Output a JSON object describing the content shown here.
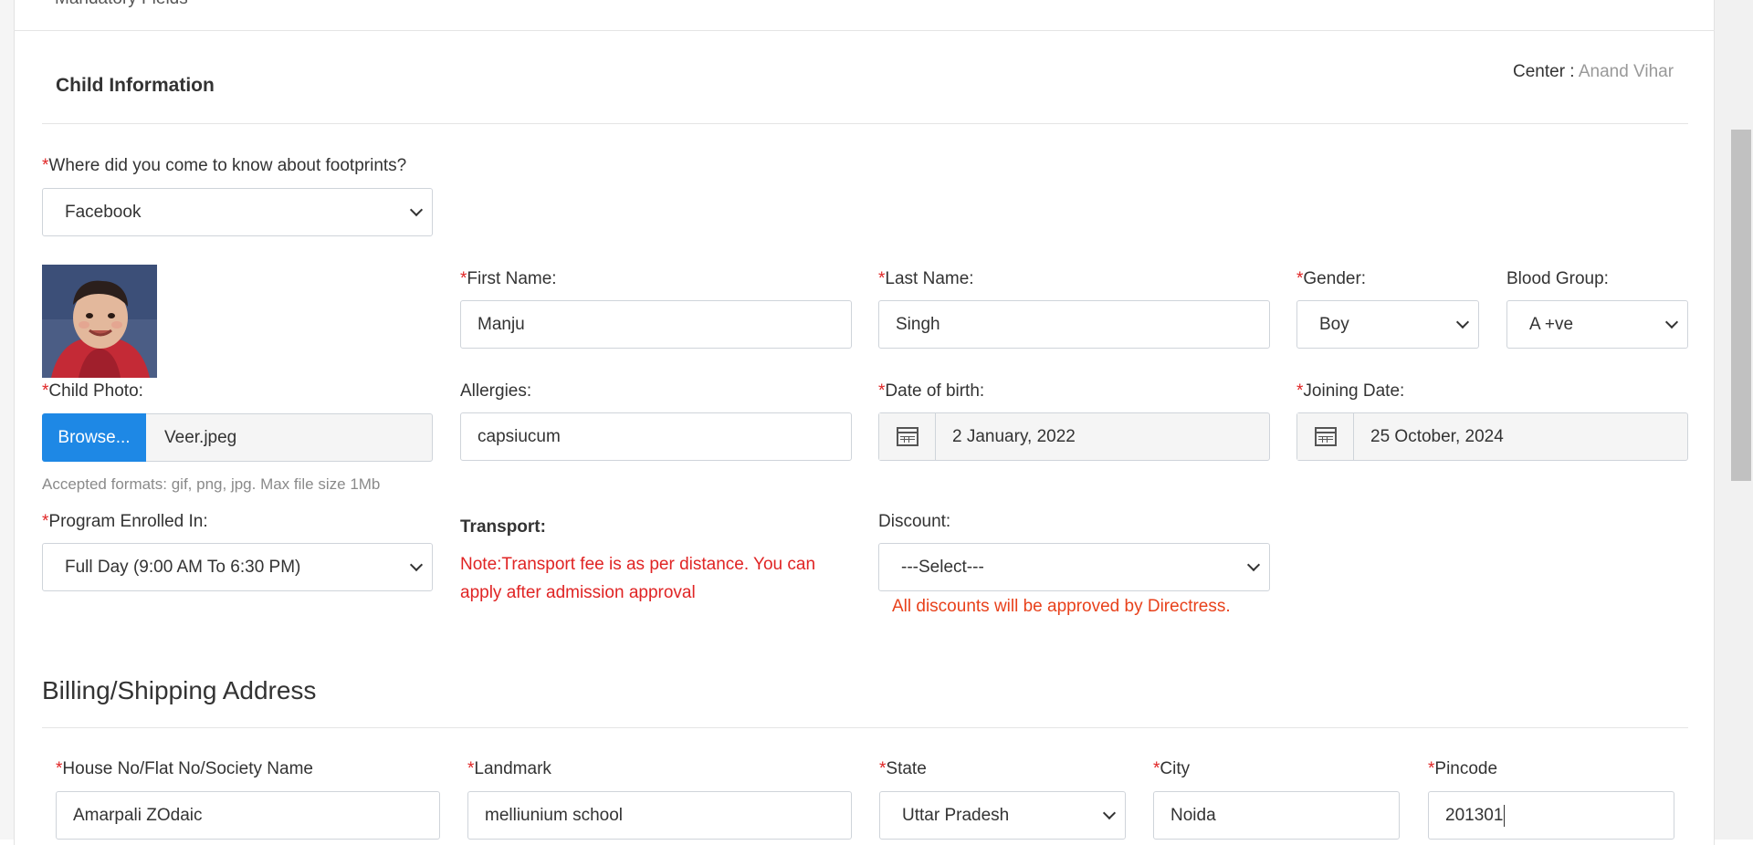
{
  "top_partial_text": "Mandatory Fields",
  "section": {
    "title": "Child Information",
    "center_label": "Center : ",
    "center_value": "Anand Vihar"
  },
  "required_mark": "*",
  "source": {
    "label": "Where did you come to know about footprints?",
    "value": "Facebook"
  },
  "first_name": {
    "label": "First Name:",
    "value": "Manju"
  },
  "last_name": {
    "label": "Last Name:",
    "value": "Singh"
  },
  "gender": {
    "label": "Gender:",
    "value": "Boy"
  },
  "blood_group": {
    "label": "Blood Group:",
    "value": "A +ve"
  },
  "photo": {
    "label": "Child Photo:",
    "browse_label": "Browse...",
    "file_name": "Veer.jpeg",
    "hint": "Accepted formats: gif, png, jpg. Max file size 1Mb"
  },
  "allergies": {
    "label": "Allergies:",
    "value": "capsiucum"
  },
  "dob": {
    "label": "Date of birth:",
    "value": "2 January, 2022"
  },
  "joining": {
    "label": "Joining Date:",
    "value": "25 October, 2024"
  },
  "program": {
    "label": "Program Enrolled In:",
    "value": "Full Day (9:00 AM To 6:30 PM)"
  },
  "transport": {
    "label": "Transport:",
    "note_line1": "Note:Transport fee is as per distance. You can",
    "note_line2": "apply after admission approval"
  },
  "discount": {
    "label": "Discount:",
    "value": "---Select---",
    "note": "All discounts will be approved by Directress."
  },
  "address": {
    "title": "Billing/Shipping Address",
    "house_label": "House No/Flat No/Society Name",
    "house_value": "Amarpali ZOdaic",
    "landmark_label": "Landmark",
    "landmark_value": "melliunium school",
    "state_label": "State",
    "state_value": "Uttar Pradesh",
    "city_label": "City",
    "city_value": "Noida",
    "pincode_label": "Pincode",
    "pincode_value": "201301"
  },
  "icons": [
    "chevron-down-icon",
    "calendar-icon"
  ],
  "colors": {
    "required": "#e02424",
    "browse": "#1e88e5",
    "center_value": "#999999",
    "note_orange": "#e8411b"
  }
}
